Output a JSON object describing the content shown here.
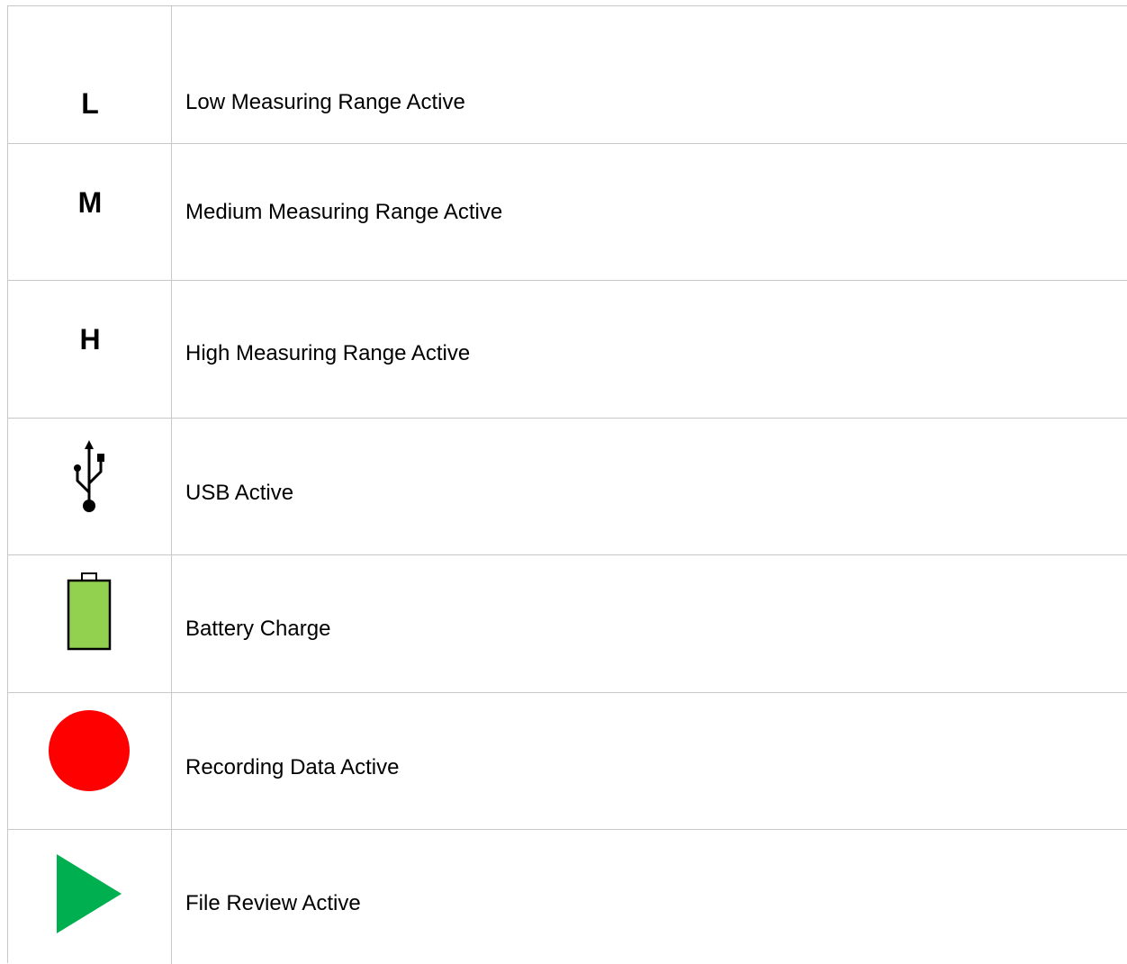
{
  "legend": {
    "rows": [
      {
        "symbol": "L",
        "icon": "low-range-letter",
        "description": "Low Measuring Range Active"
      },
      {
        "symbol": "M",
        "icon": "medium-range-letter",
        "description": "Medium Measuring Range Active"
      },
      {
        "symbol": "H",
        "icon": "high-range-letter",
        "description": "High Measuring Range Active"
      },
      {
        "symbol": "",
        "icon": "usb-icon",
        "description": "USB Active"
      },
      {
        "symbol": "",
        "icon": "battery-icon",
        "description": "Battery Charge"
      },
      {
        "symbol": "",
        "icon": "record-icon",
        "description": "Recording Data Active"
      },
      {
        "symbol": "",
        "icon": "play-icon",
        "description": "File Review Active"
      }
    ]
  },
  "colors": {
    "grid_line": "#c8c8c8",
    "battery_fill": "#92d050",
    "record_red": "#ff0000",
    "play_green": "#00b050"
  }
}
